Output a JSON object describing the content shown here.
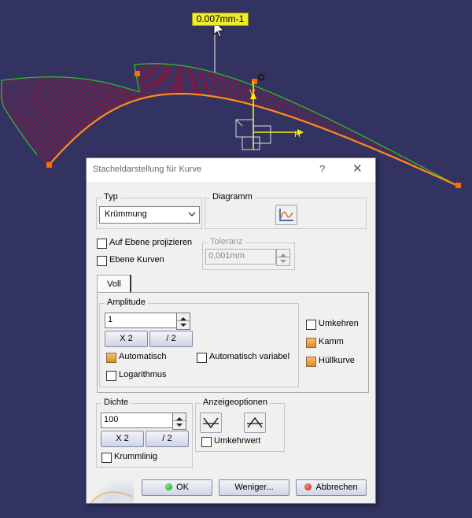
{
  "viewport": {
    "curvature_label": "0.007mm-1",
    "axis_h_label": "H",
    "axis_v_label": "V",
    "colors": {
      "background": "#333362",
      "comb": "#a0143a",
      "envelope": "#2fb82f",
      "curve": "#ff8c1a",
      "point": "#ff6a00",
      "axis": "#f0f000"
    }
  },
  "dialog": {
    "title": "Stacheldarstellung für Kurve",
    "help": "?",
    "close": "✕",
    "typ": {
      "label": "Typ",
      "selected": "Krümmung"
    },
    "diagramm": {
      "label": "Diagramm"
    },
    "options": {
      "auf_ebene": "Auf Ebene projizieren",
      "ebene_kurven": "Ebene Kurven"
    },
    "toleranz": {
      "label": "Toleranz",
      "value": "0,001mm"
    },
    "tab_voll": "Voll",
    "amplitude": {
      "label": "Amplitude",
      "value": "1",
      "x2": "X 2",
      "div2": "/ 2",
      "automatisch": "Automatisch",
      "automatisch_variabel": "Automatisch variabel",
      "logarithmus": "Logarithmus"
    },
    "umkehren": "Umkehren",
    "kamm": "Kamm",
    "huellkurve": "Hüllkurve",
    "dichte": {
      "label": "Dichte",
      "value": "100",
      "x2": "X 2",
      "div2": "/ 2",
      "krummlinig": "Krummlinig"
    },
    "anzeige": {
      "label": "Anzeigeoptionen",
      "umkehrwert": "Umkehrwert"
    },
    "buttons": {
      "ok": "OK",
      "weniger": "Weniger...",
      "abbrechen": "Abbrechen"
    }
  }
}
